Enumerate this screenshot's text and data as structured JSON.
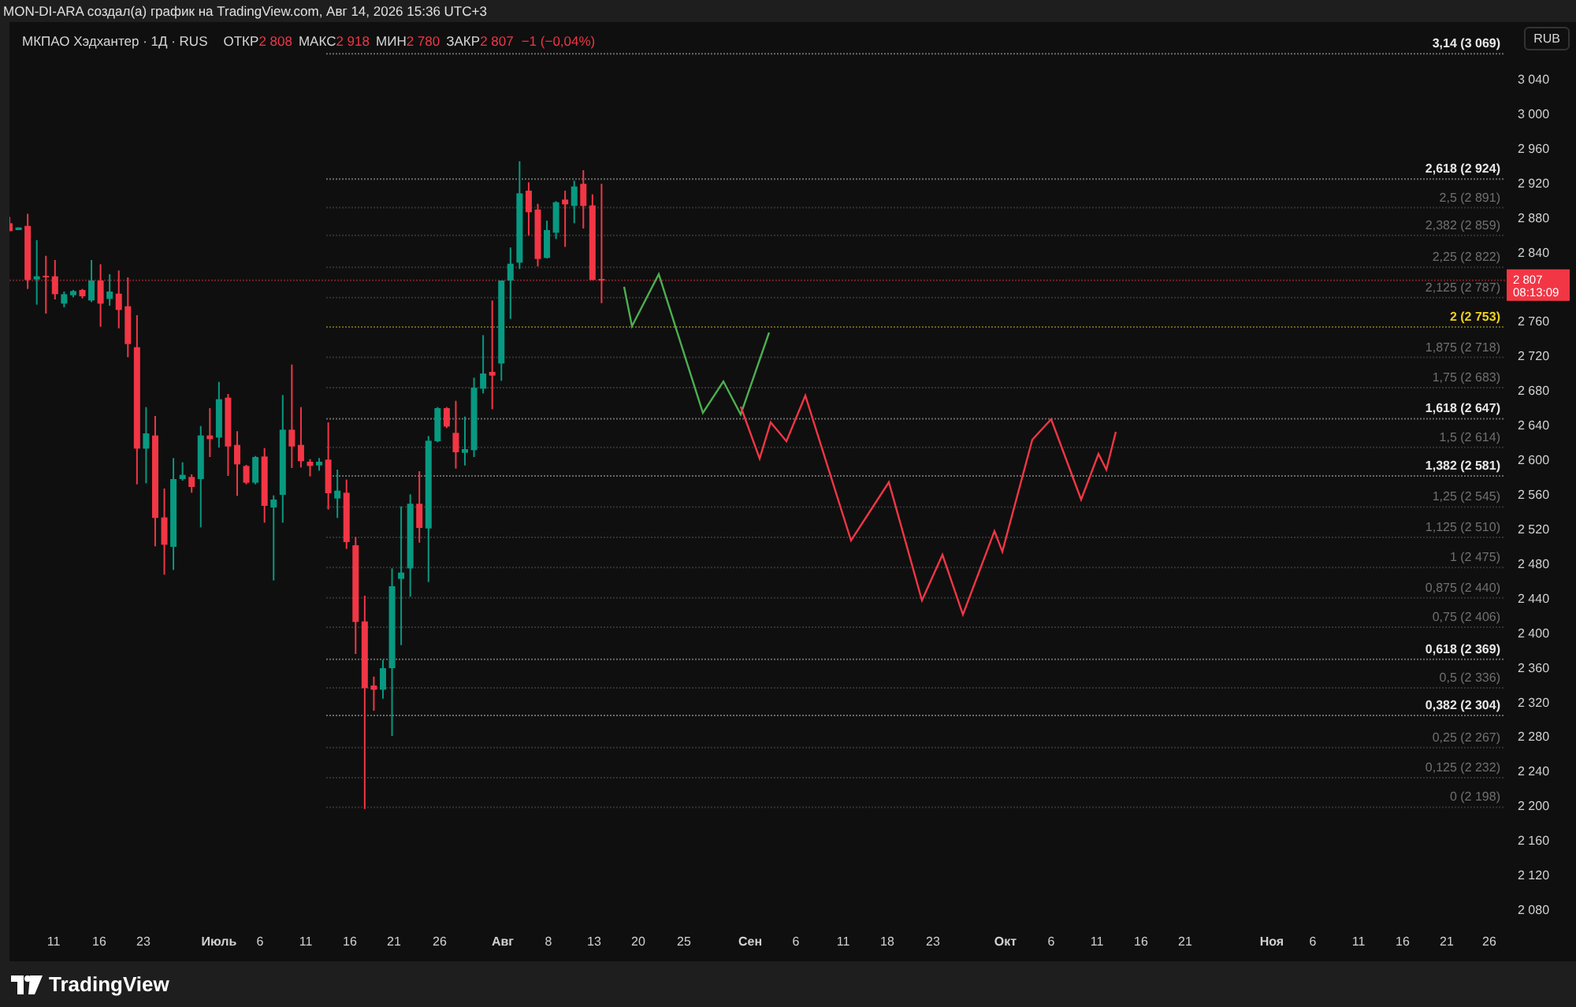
{
  "header": {
    "text": "MON-DI-ARA создал(а) график на TradingView.com, Авг 14, 2026 15:36 UTC+3"
  },
  "legend": {
    "symbol": "МКПАО Хэдхантер · 1Д · RUS",
    "fields": [
      {
        "label": "ОТКР",
        "value": "2 808"
      },
      {
        "label": "МАКС",
        "value": "2 918"
      },
      {
        "label": "МИН",
        "value": "2 780"
      },
      {
        "label": "ЗАКР",
        "value": "2 807"
      }
    ],
    "change": "−1 (−0,04%)"
  },
  "currency_button": "RUB",
  "fib_levels": [
    {
      "label": "3,14 (3 069)",
      "kind": "major"
    },
    {
      "label": "2,618 (2 924)",
      "kind": "major"
    },
    {
      "label": "2,5 (2 891)",
      "kind": "minor"
    },
    {
      "label": "2,382 (2 859)",
      "kind": "minor"
    },
    {
      "label": "2,25 (2 822)",
      "kind": "minor"
    },
    {
      "label": "2,125 (2 787)",
      "kind": "minor"
    },
    {
      "label": "2 (2 753)",
      "kind": "highlight"
    },
    {
      "label": "1,875 (2 718)",
      "kind": "minor"
    },
    {
      "label": "1,75 (2 683)",
      "kind": "minor"
    },
    {
      "label": "1,618 (2 647)",
      "kind": "major"
    },
    {
      "label": "1,5 (2 614)",
      "kind": "minor"
    },
    {
      "label": "1,382 (2 581)",
      "kind": "major"
    },
    {
      "label": "1,25 (2 545)",
      "kind": "minor"
    },
    {
      "label": "1,125 (2 510)",
      "kind": "minor"
    },
    {
      "label": "1 (2 475)",
      "kind": "minor"
    },
    {
      "label": "0,875 (2 440)",
      "kind": "minor"
    },
    {
      "label": "0,75 (2 406)",
      "kind": "minor"
    },
    {
      "label": "0,618 (2 369)",
      "kind": "major"
    },
    {
      "label": "0,5 (2 336)",
      "kind": "minor"
    },
    {
      "label": "0,382 (2 304)",
      "kind": "major"
    },
    {
      "label": "0,25 (2 267)",
      "kind": "minor"
    },
    {
      "label": "0,125 (2 232)",
      "kind": "minor"
    },
    {
      "label": "0 (2 198)",
      "kind": "minor"
    }
  ],
  "price_axis": [
    "3 040",
    "3 000",
    "2 960",
    "2 920",
    "2 880",
    "2 840",
    "2 760",
    "2 720",
    "2 680",
    "2 640",
    "2 600",
    "2 560",
    "2 520",
    "2 480",
    "2 440",
    "2 400",
    "2 360",
    "2 320",
    "2 280",
    "2 240",
    "2 200",
    "2 160",
    "2 120",
    "2 080"
  ],
  "current_price": {
    "price": "2 807",
    "countdown": "08:13:09"
  },
  "time_axis": [
    {
      "label": "11",
      "kind": "day"
    },
    {
      "label": "16",
      "kind": "day"
    },
    {
      "label": "23",
      "kind": "day"
    },
    {
      "label": "Июль",
      "kind": "month"
    },
    {
      "label": "6",
      "kind": "day"
    },
    {
      "label": "11",
      "kind": "day"
    },
    {
      "label": "16",
      "kind": "day"
    },
    {
      "label": "21",
      "kind": "day"
    },
    {
      "label": "26",
      "kind": "day"
    },
    {
      "label": "Авг",
      "kind": "month"
    },
    {
      "label": "8",
      "kind": "day"
    },
    {
      "label": "13",
      "kind": "day"
    },
    {
      "label": "20",
      "kind": "day"
    },
    {
      "label": "25",
      "kind": "day"
    },
    {
      "label": "Сен",
      "kind": "month"
    },
    {
      "label": "6",
      "kind": "day"
    },
    {
      "label": "11",
      "kind": "day"
    },
    {
      "label": "18",
      "kind": "day"
    },
    {
      "label": "23",
      "kind": "day"
    },
    {
      "label": "Окт",
      "kind": "month"
    },
    {
      "label": "6",
      "kind": "day"
    },
    {
      "label": "11",
      "kind": "day"
    },
    {
      "label": "16",
      "kind": "day"
    },
    {
      "label": "21",
      "kind": "day"
    },
    {
      "label": "Ноя",
      "kind": "month"
    },
    {
      "label": "6",
      "kind": "day"
    },
    {
      "label": "11",
      "kind": "day"
    },
    {
      "label": "16",
      "kind": "day"
    },
    {
      "label": "21",
      "kind": "day"
    },
    {
      "label": "26",
      "kind": "day"
    }
  ],
  "footer": {
    "brand": "TradingView"
  }
}
